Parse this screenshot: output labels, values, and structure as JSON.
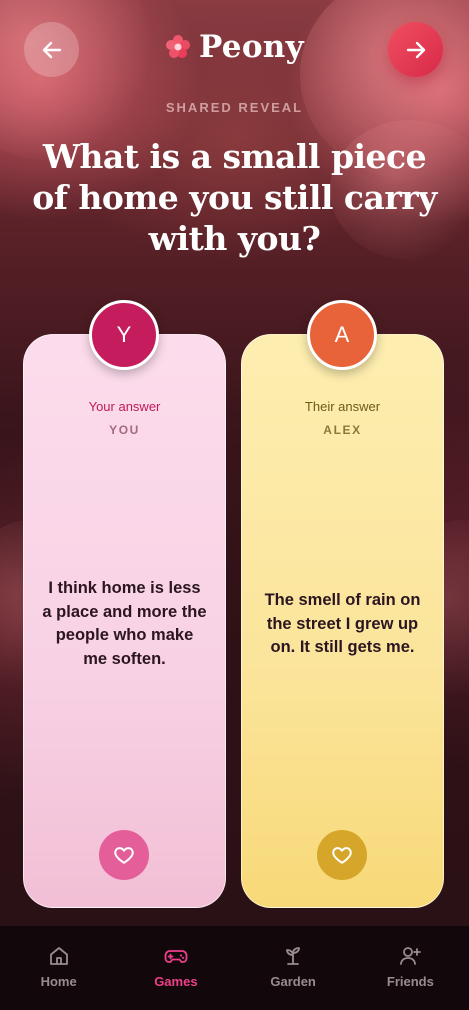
{
  "header": {
    "brand": "Peony",
    "back_icon": "arrow-left-icon",
    "next_icon": "arrow-right-icon",
    "brand_icon": "flower-icon"
  },
  "kicker": "SHARED REVEAL",
  "question": "What is a small piece of home you still carry with you?",
  "cards": [
    {
      "initial": "Y",
      "label": "Your answer",
      "name": "YOU",
      "text": "I think home is less a place and more the people who make me soften.",
      "avatar_color": "#c41c5c",
      "heart_icon": "heart-icon"
    },
    {
      "initial": "A",
      "label": "Their answer",
      "name": "ALEX",
      "text": "The smell of rain on the street I grew up on. It still gets me.",
      "avatar_color": "#e9633a",
      "heart_icon": "heart-icon"
    }
  ],
  "tabs": [
    {
      "label": "Home",
      "icon": "house-icon",
      "active": false
    },
    {
      "label": "Games",
      "icon": "gamepad-icon",
      "active": true
    },
    {
      "label": "Garden",
      "icon": "sprout-icon",
      "active": false
    },
    {
      "label": "Friends",
      "icon": "user-plus-icon",
      "active": false
    }
  ],
  "colors": {
    "accent": "#ef3f8a",
    "next_button": "#e23a55"
  }
}
